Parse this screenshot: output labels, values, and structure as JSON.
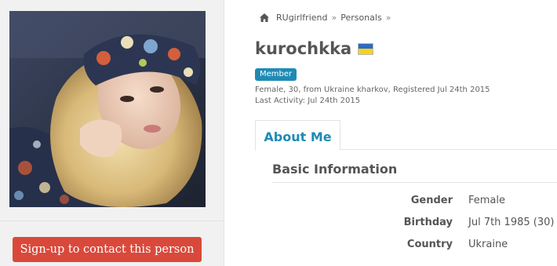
{
  "breadcrumb": {
    "items": [
      "RUgirlfriend",
      "Personals"
    ],
    "separator": "»"
  },
  "profile": {
    "username": "kurochkka",
    "country_flag": "ukraine-flag",
    "badge": "Member",
    "summary": "Female, 30, from Ukraine kharkov, Registered Jul 24th 2015",
    "last_activity": "Last Activity: Jul 24th 2015"
  },
  "tabs": [
    {
      "label": "About Me",
      "active": true
    }
  ],
  "basic_info": {
    "title": "Basic Information",
    "rows": [
      {
        "label": "Gender",
        "value": "Female"
      },
      {
        "label": "Birthday",
        "value": "Jul 7th 1985 (30)"
      },
      {
        "label": "Country",
        "value": "Ukraine"
      }
    ]
  },
  "actions": {
    "signup_label": "Sign-up to contact this person"
  },
  "colors": {
    "accent": "#1e8bb5",
    "signup_button": "#d9493b",
    "sidebar_bg": "#f1f1f1"
  }
}
